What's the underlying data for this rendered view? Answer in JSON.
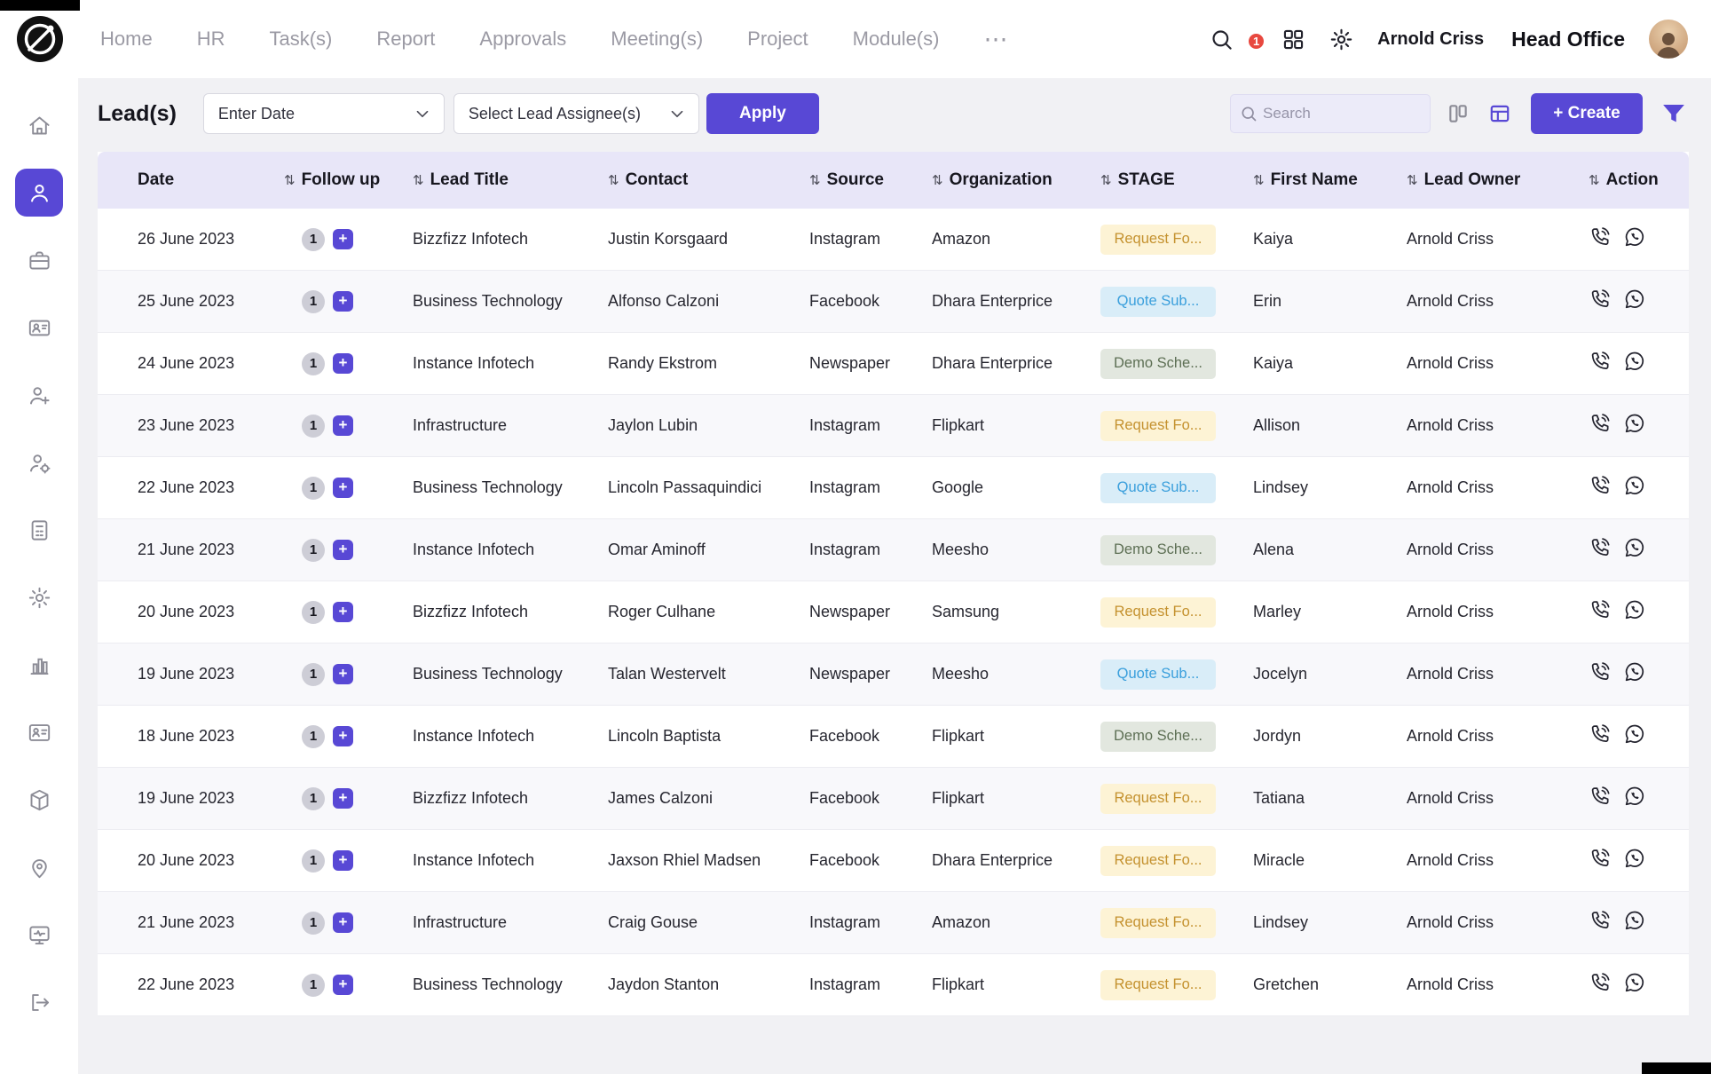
{
  "topnav": {
    "items": [
      "Home",
      "HR",
      "Task(s)",
      "Report",
      "Approvals",
      "Meeting(s)",
      "Project",
      "Module(s)"
    ],
    "overflow_label": "⋯",
    "notification_count": "1",
    "user_name": "Arnold Criss",
    "office_name": "Head Office"
  },
  "sidebar": {
    "icons": [
      "home",
      "leads",
      "briefcase",
      "meetings",
      "add-user",
      "user-settings",
      "invoices",
      "settings",
      "reports",
      "contacts",
      "products",
      "location-pin",
      "activity-monitor",
      "logout"
    ],
    "active": "leads"
  },
  "page": {
    "title": "Lead(s)",
    "date_filter_placeholder": "Enter Date",
    "assignee_filter_placeholder": "Select Lead Assignee(s)",
    "apply_label": "Apply",
    "search_placeholder": "Search",
    "create_label": "+ Create"
  },
  "table": {
    "sort_icon": "⇅",
    "followup_add_label": "+",
    "columns": [
      "Date",
      "Follow up",
      "Lead Title",
      "Contact",
      "Source",
      "Organization",
      "STAGE",
      "First Name",
      "Lead Owner",
      "Action"
    ],
    "rows": [
      {
        "date": "26 June 2023",
        "followup_count": "1",
        "lead_title": "Bizzfizz Infotech",
        "contact": "Justin Korsgaard",
        "source": "Instagram",
        "organization": "Amazon",
        "stage": "Request Fo...",
        "stage_type": "request",
        "first_name": "Kaiya",
        "lead_owner": "Arnold Criss"
      },
      {
        "date": "25 June 2023",
        "followup_count": "1",
        "lead_title": "Business Technology",
        "contact": "Alfonso Calzoni",
        "source": "Facebook",
        "organization": "Dhara Enterprice",
        "stage": "Quote Sub...",
        "stage_type": "quote",
        "first_name": "Erin",
        "lead_owner": "Arnold Criss"
      },
      {
        "date": "24 June 2023",
        "followup_count": "1",
        "lead_title": "Instance Infotech",
        "contact": "Randy Ekstrom",
        "source": "Newspaper",
        "organization": "Dhara Enterprice",
        "stage": "Demo Sche...",
        "stage_type": "demo",
        "first_name": "Kaiya",
        "lead_owner": "Arnold Criss"
      },
      {
        "date": "23 June 2023",
        "followup_count": "1",
        "lead_title": "Infrastructure",
        "contact": "Jaylon Lubin",
        "source": "Instagram",
        "organization": "Flipkart",
        "stage": "Request Fo...",
        "stage_type": "request",
        "first_name": "Allison",
        "lead_owner": "Arnold Criss"
      },
      {
        "date": "22 June 2023",
        "followup_count": "1",
        "lead_title": "Business Technology",
        "contact": "Lincoln Passaquindici",
        "source": "Instagram",
        "organization": "Google",
        "stage": "Quote Sub...",
        "stage_type": "quote",
        "first_name": "Lindsey",
        "lead_owner": "Arnold Criss"
      },
      {
        "date": "21 June 2023",
        "followup_count": "1",
        "lead_title": "Instance Infotech",
        "contact": "Omar Aminoff",
        "source": "Instagram",
        "organization": "Meesho",
        "stage": "Demo Sche...",
        "stage_type": "demo",
        "first_name": "Alena",
        "lead_owner": "Arnold Criss"
      },
      {
        "date": "20 June 2023",
        "followup_count": "1",
        "lead_title": "Bizzfizz Infotech",
        "contact": "Roger Culhane",
        "source": "Newspaper",
        "organization": "Samsung",
        "stage": "Request Fo...",
        "stage_type": "request",
        "first_name": "Marley",
        "lead_owner": "Arnold Criss"
      },
      {
        "date": "19 June 2023",
        "followup_count": "1",
        "lead_title": "Business Technology",
        "contact": "Talan Westervelt",
        "source": "Newspaper",
        "organization": "Meesho",
        "stage": "Quote Sub...",
        "stage_type": "quote",
        "first_name": "Jocelyn",
        "lead_owner": "Arnold Criss"
      },
      {
        "date": "18 June 2023",
        "followup_count": "1",
        "lead_title": "Instance Infotech",
        "contact": "Lincoln Baptista",
        "source": "Facebook",
        "organization": "Flipkart",
        "stage": "Demo Sche...",
        "stage_type": "demo",
        "first_name": "Jordyn",
        "lead_owner": "Arnold Criss"
      },
      {
        "date": "19 June 2023",
        "followup_count": "1",
        "lead_title": "Bizzfizz Infotech",
        "contact": "James Calzoni",
        "source": "Facebook",
        "organization": "Flipkart",
        "stage": "Request Fo...",
        "stage_type": "request",
        "first_name": "Tatiana",
        "lead_owner": "Arnold Criss"
      },
      {
        "date": "20 June 2023",
        "followup_count": "1",
        "lead_title": "Instance Infotech",
        "contact": "Jaxson Rhiel Madsen",
        "source": "Facebook",
        "organization": "Dhara Enterprice",
        "stage": "Request Fo...",
        "stage_type": "request",
        "first_name": "Miracle",
        "lead_owner": "Arnold Criss"
      },
      {
        "date": "21 June 2023",
        "followup_count": "1",
        "lead_title": "Infrastructure",
        "contact": "Craig Gouse",
        "source": "Instagram",
        "organization": "Amazon",
        "stage": "Request Fo...",
        "stage_type": "request",
        "first_name": "Lindsey",
        "lead_owner": "Arnold Criss"
      },
      {
        "date": "22 June 2023",
        "followup_count": "1",
        "lead_title": "Business Technology",
        "contact": "Jaydon Stanton",
        "source": "Instagram",
        "organization": "Flipkart",
        "stage": "Request Fo...",
        "stage_type": "request",
        "first_name": "Gretchen",
        "lead_owner": "Arnold Criss"
      }
    ]
  },
  "colors": {
    "accent": "#5848d5",
    "table_header_bg": "#e8e6f8",
    "stage_request_bg": "#fdf3d5",
    "stage_request_text": "#c4912e",
    "stage_quote_bg": "#d9edf8",
    "stage_quote_text": "#3a9fdc",
    "stage_demo_bg": "#e2e7df",
    "stage_demo_text": "#5d6f54",
    "notification_red": "#e8483f"
  }
}
